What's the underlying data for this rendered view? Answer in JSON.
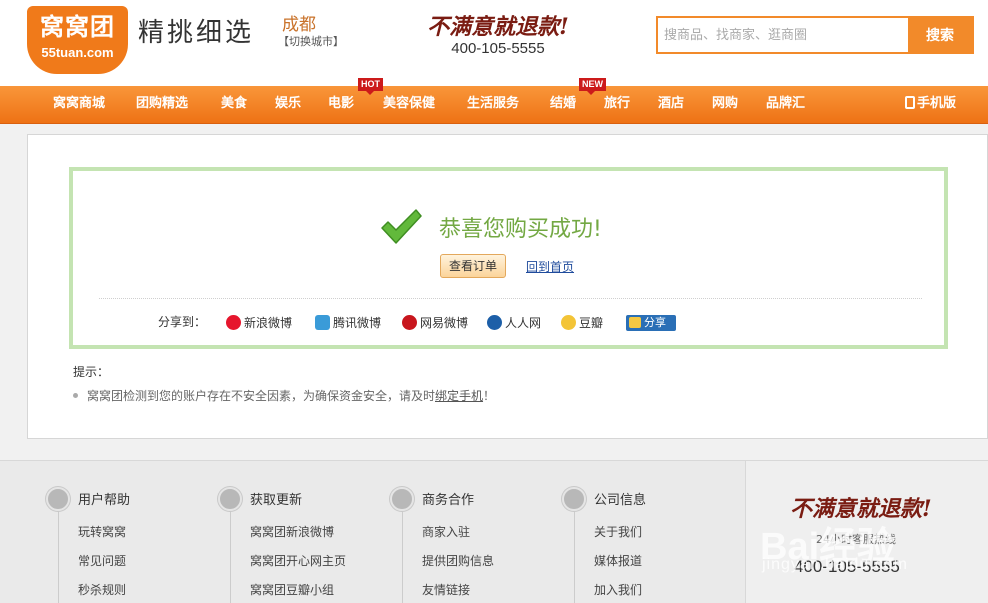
{
  "header": {
    "logo_main": "窝窝团",
    "logo_sub": "55tuan.com",
    "slogan": "精挑细选",
    "city": "成都",
    "city_switch": "【切换城市】",
    "guarantee_title": "不满意就退款!",
    "guarantee_phone": "400-105-5555",
    "search_placeholder": "搜商品、找商家、逛商圈",
    "search_button": "搜索"
  },
  "nav": {
    "items": [
      {
        "label": "窝窝商城"
      },
      {
        "label": "团购精选"
      },
      {
        "label": "美食"
      },
      {
        "label": "娱乐"
      },
      {
        "label": "电影",
        "badge": "HOT"
      },
      {
        "label": "美容保健"
      },
      {
        "label": "生活服务"
      },
      {
        "label": "结婚",
        "badge": "NEW"
      },
      {
        "label": "旅行"
      },
      {
        "label": "酒店"
      },
      {
        "label": "网购"
      },
      {
        "label": "品牌汇"
      }
    ],
    "mobile": "手机版"
  },
  "success": {
    "message": "恭喜您购买成功!",
    "view_order": "查看订单",
    "back_home": "回到首页",
    "share_label": "分享到：",
    "share_targets": [
      "新浪微博",
      "腾讯微博",
      "网易微博",
      "人人网",
      "豆瓣"
    ],
    "share_button": "分享"
  },
  "tips": {
    "title": "提示：",
    "line_prefix": "窝窝团检测到您的账户存在不安全因素，为确保资金安全，请及时",
    "line_link": "绑定手机",
    "line_suffix": "！"
  },
  "footer": {
    "columns": [
      {
        "title": "用户帮助",
        "links": [
          "玩转窝窝",
          "常见问题",
          "秒杀规则"
        ]
      },
      {
        "title": "获取更新",
        "links": [
          "窝窝团新浪微博",
          "窝窝团开心网主页",
          "窝窝团豆瓣小组"
        ]
      },
      {
        "title": "商务合作",
        "links": [
          "商家入驻",
          "提供团购信息",
          "友情链接"
        ]
      },
      {
        "title": "公司信息",
        "links": [
          "关于我们",
          "媒体报道",
          "加入我们"
        ]
      }
    ],
    "guarantee_title": "不满意就退款!",
    "service_text": "24小时客服热线",
    "phone": "400-105-5555"
  },
  "watermark": {
    "text": "Bai经验",
    "sub": "jingyan.baidu.com"
  },
  "colors": {
    "brand_orange": "#f28a2a",
    "success_green": "#73a843",
    "success_border": "#c4e4b2"
  }
}
